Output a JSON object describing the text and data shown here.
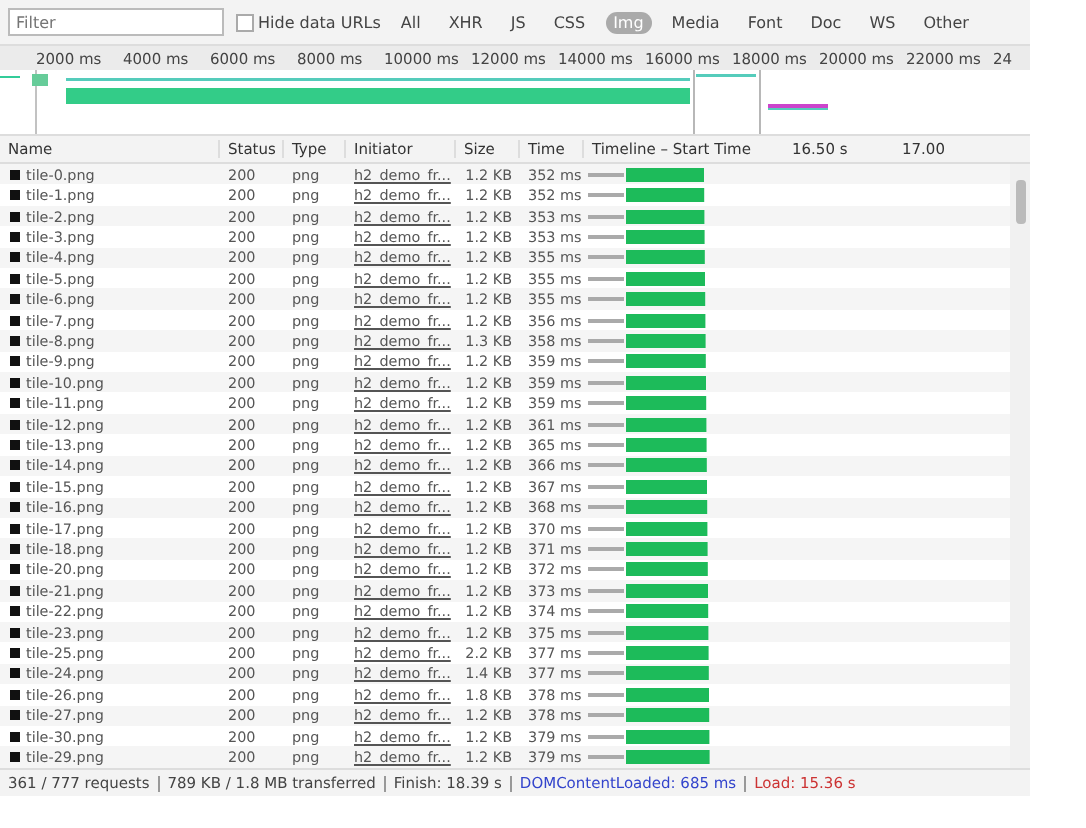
{
  "toolbar": {
    "filter": {
      "placeholder": "Filter"
    },
    "hide_data_urls": {
      "label": "Hide data URLs",
      "checked": false
    },
    "types": [
      {
        "label": "All",
        "selected": false
      },
      {
        "label": "XHR",
        "selected": false
      },
      {
        "label": "JS",
        "selected": false
      },
      {
        "label": "CSS",
        "selected": false
      },
      {
        "label": "Img",
        "selected": true
      },
      {
        "label": "Media",
        "selected": false
      },
      {
        "label": "Font",
        "selected": false
      },
      {
        "label": "Doc",
        "selected": false
      },
      {
        "label": "WS",
        "selected": false
      },
      {
        "label": "Other",
        "selected": false
      }
    ]
  },
  "overview": {
    "ticks": [
      "2000 ms",
      "4000 ms",
      "6000 ms",
      "8000 ms",
      "10000 ms",
      "12000 ms",
      "14000 ms",
      "16000 ms",
      "18000 ms",
      "20000 ms",
      "22000 ms",
      "24"
    ]
  },
  "table": {
    "columns": [
      "Name",
      "Status",
      "Type",
      "Initiator",
      "Size",
      "Time",
      "Timeline – Start Time"
    ],
    "timeline_ticks": [
      "16.50 s",
      "17.00"
    ],
    "rows": [
      {
        "name": "tile-0.png",
        "status": "200",
        "type": "png",
        "initiator": "h2_demo_fr...",
        "size": "1.2 KB",
        "time": "352 ms"
      },
      {
        "name": "tile-1.png",
        "status": "200",
        "type": "png",
        "initiator": "h2_demo_fr...",
        "size": "1.2 KB",
        "time": "352 ms"
      },
      {
        "name": "tile-2.png",
        "status": "200",
        "type": "png",
        "initiator": "h2_demo_fr...",
        "size": "1.2 KB",
        "time": "353 ms"
      },
      {
        "name": "tile-3.png",
        "status": "200",
        "type": "png",
        "initiator": "h2_demo_fr...",
        "size": "1.2 KB",
        "time": "353 ms"
      },
      {
        "name": "tile-4.png",
        "status": "200",
        "type": "png",
        "initiator": "h2_demo_fr...",
        "size": "1.2 KB",
        "time": "355 ms"
      },
      {
        "name": "tile-5.png",
        "status": "200",
        "type": "png",
        "initiator": "h2_demo_fr...",
        "size": "1.2 KB",
        "time": "355 ms"
      },
      {
        "name": "tile-6.png",
        "status": "200",
        "type": "png",
        "initiator": "h2_demo_fr...",
        "size": "1.2 KB",
        "time": "355 ms"
      },
      {
        "name": "tile-7.png",
        "status": "200",
        "type": "png",
        "initiator": "h2_demo_fr...",
        "size": "1.2 KB",
        "time": "356 ms"
      },
      {
        "name": "tile-8.png",
        "status": "200",
        "type": "png",
        "initiator": "h2_demo_fr...",
        "size": "1.3 KB",
        "time": "358 ms"
      },
      {
        "name": "tile-9.png",
        "status": "200",
        "type": "png",
        "initiator": "h2_demo_fr...",
        "size": "1.2 KB",
        "time": "359 ms"
      },
      {
        "name": "tile-10.png",
        "status": "200",
        "type": "png",
        "initiator": "h2_demo_fr...",
        "size": "1.2 KB",
        "time": "359 ms"
      },
      {
        "name": "tile-11.png",
        "status": "200",
        "type": "png",
        "initiator": "h2_demo_fr...",
        "size": "1.2 KB",
        "time": "359 ms"
      },
      {
        "name": "tile-12.png",
        "status": "200",
        "type": "png",
        "initiator": "h2_demo_fr...",
        "size": "1.2 KB",
        "time": "361 ms"
      },
      {
        "name": "tile-13.png",
        "status": "200",
        "type": "png",
        "initiator": "h2_demo_fr...",
        "size": "1.2 KB",
        "time": "365 ms"
      },
      {
        "name": "tile-14.png",
        "status": "200",
        "type": "png",
        "initiator": "h2_demo_fr...",
        "size": "1.2 KB",
        "time": "366 ms"
      },
      {
        "name": "tile-15.png",
        "status": "200",
        "type": "png",
        "initiator": "h2_demo_fr...",
        "size": "1.2 KB",
        "time": "367 ms"
      },
      {
        "name": "tile-16.png",
        "status": "200",
        "type": "png",
        "initiator": "h2_demo_fr...",
        "size": "1.2 KB",
        "time": "368 ms"
      },
      {
        "name": "tile-17.png",
        "status": "200",
        "type": "png",
        "initiator": "h2_demo_fr...",
        "size": "1.2 KB",
        "time": "370 ms"
      },
      {
        "name": "tile-18.png",
        "status": "200",
        "type": "png",
        "initiator": "h2_demo_fr...",
        "size": "1.2 KB",
        "time": "371 ms"
      },
      {
        "name": "tile-20.png",
        "status": "200",
        "type": "png",
        "initiator": "h2_demo_fr...",
        "size": "1.2 KB",
        "time": "372 ms"
      },
      {
        "name": "tile-21.png",
        "status": "200",
        "type": "png",
        "initiator": "h2_demo_fr...",
        "size": "1.2 KB",
        "time": "373 ms"
      },
      {
        "name": "tile-22.png",
        "status": "200",
        "type": "png",
        "initiator": "h2_demo_fr...",
        "size": "1.2 KB",
        "time": "374 ms"
      },
      {
        "name": "tile-23.png",
        "status": "200",
        "type": "png",
        "initiator": "h2_demo_fr...",
        "size": "1.2 KB",
        "time": "375 ms"
      },
      {
        "name": "tile-25.png",
        "status": "200",
        "type": "png",
        "initiator": "h2_demo_fr...",
        "size": "2.2 KB",
        "time": "377 ms"
      },
      {
        "name": "tile-24.png",
        "status": "200",
        "type": "png",
        "initiator": "h2_demo_fr...",
        "size": "1.4 KB",
        "time": "377 ms"
      },
      {
        "name": "tile-26.png",
        "status": "200",
        "type": "png",
        "initiator": "h2_demo_fr...",
        "size": "1.8 KB",
        "time": "378 ms"
      },
      {
        "name": "tile-27.png",
        "status": "200",
        "type": "png",
        "initiator": "h2_demo_fr...",
        "size": "1.2 KB",
        "time": "378 ms"
      },
      {
        "name": "tile-30.png",
        "status": "200",
        "type": "png",
        "initiator": "h2_demo_fr...",
        "size": "1.2 KB",
        "time": "379 ms"
      },
      {
        "name": "tile-29.png",
        "status": "200",
        "type": "png",
        "initiator": "h2_demo_fr...",
        "size": "1.2 KB",
        "time": "379 ms"
      }
    ]
  },
  "status_bar": [
    {
      "text": "361 / 777 requests",
      "kind": "plain"
    },
    {
      "text": "789 KB / 1.8 MB transferred",
      "kind": "plain"
    },
    {
      "text": "Finish: 18.39 s",
      "kind": "plain"
    },
    {
      "text": "DOMContentLoaded: 685 ms",
      "kind": "dom"
    },
    {
      "text": "Load: 15.36 s",
      "kind": "load"
    }
  ]
}
